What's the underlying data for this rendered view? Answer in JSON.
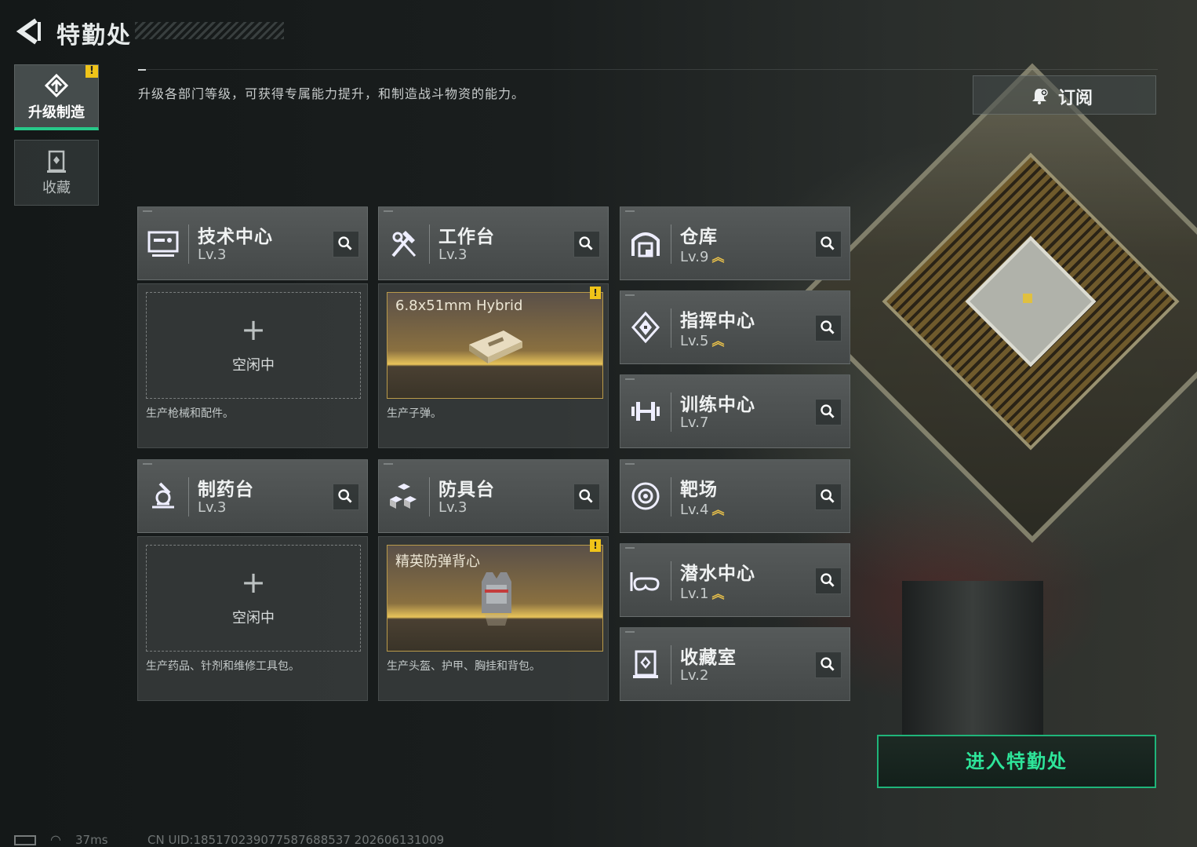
{
  "header": {
    "back_icon": "back-arrow-icon",
    "title": "特勤处"
  },
  "sidebar": {
    "tabs": [
      {
        "label": "升级制造",
        "icon": "upgrade-craft-icon",
        "active": true,
        "alert": "!"
      },
      {
        "label": "收藏",
        "icon": "collection-icon",
        "active": false
      }
    ]
  },
  "intro_text": "升级各部门等级，可获得专属能力提升，和制造战斗物资的能力。",
  "subscribe": {
    "label": "订阅",
    "icon": "bell-plus-icon"
  },
  "departments": [
    {
      "id": "tech-center",
      "name": "技术中心",
      "level": "Lv.3",
      "upgradable": false,
      "icon": "computer-icon"
    },
    {
      "id": "workbench",
      "name": "工作台",
      "level": "Lv.3",
      "upgradable": false,
      "icon": "hammer-wrench-icon"
    },
    {
      "id": "warehouse",
      "name": "仓库",
      "level": "Lv.9",
      "upgradable": true,
      "icon": "warehouse-icon"
    },
    {
      "id": "command-center",
      "name": "指挥中心",
      "level": "Lv.5",
      "upgradable": true,
      "icon": "chip-icon"
    },
    {
      "id": "training-center",
      "name": "训练中心",
      "level": "Lv.7",
      "upgradable": false,
      "icon": "dumbbell-icon"
    },
    {
      "id": "pharmacy",
      "name": "制药台",
      "level": "Lv.3",
      "upgradable": false,
      "icon": "microscope-icon"
    },
    {
      "id": "armor-bench",
      "name": "防具台",
      "level": "Lv.3",
      "upgradable": false,
      "icon": "armor-blocks-icon"
    },
    {
      "id": "shooting-range",
      "name": "靶场",
      "level": "Lv.4",
      "upgradable": true,
      "icon": "target-icon"
    },
    {
      "id": "diving-center",
      "name": "潜水中心",
      "level": "Lv.1",
      "upgradable": true,
      "icon": "goggles-icon"
    },
    {
      "id": "collection-room",
      "name": "收藏室",
      "level": "Lv.2",
      "upgradable": false,
      "icon": "display-case-icon"
    }
  ],
  "upgrade_mark": "︽",
  "search_icon": "search-icon",
  "production": {
    "tech-center": {
      "state": "idle",
      "plus": "+",
      "idle_label": "空闲中",
      "desc": "生产枪械和配件。"
    },
    "workbench": {
      "state": "producing",
      "item": "6.8x51mm Hybrid",
      "item_icon": "ammo-box-icon",
      "alert": "!",
      "desc": "生产子弹。"
    },
    "pharmacy": {
      "state": "idle",
      "plus": "+",
      "idle_label": "空闲中",
      "desc": "生产药品、针剂和维修工具包。"
    },
    "armor-bench": {
      "state": "producing",
      "item": "精英防弹背心",
      "item_icon": "vest-icon",
      "alert": "!",
      "desc": "生产头盔、护甲、胸挂和背包。"
    }
  },
  "enter_button": {
    "label": "进入特勤处"
  },
  "status_bar": {
    "ping": "37ms",
    "uid": "CN UID:185170239077587688537 202606131009"
  },
  "colors": {
    "accent_green": "#2ee59a",
    "alert_yellow": "#f0c419",
    "upgrade_gold": "#e9c14a"
  }
}
